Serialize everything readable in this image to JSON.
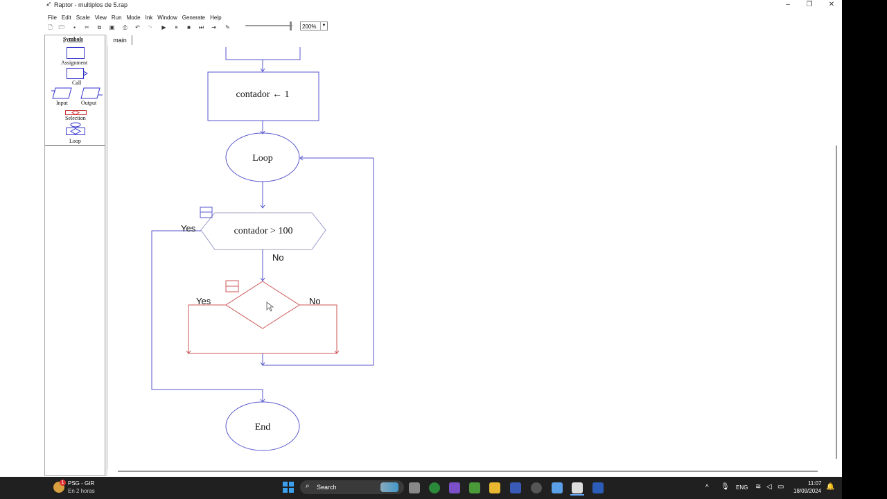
{
  "window": {
    "title": "Raptor - multiplos de 5.rap",
    "app_icon": "raptor-icon",
    "minimize": "–",
    "restore": "❐",
    "close": "✕"
  },
  "menu": [
    "File",
    "Edit",
    "Scale",
    "View",
    "Run",
    "Mode",
    "Ink",
    "Window",
    "Generate",
    "Help"
  ],
  "toolbar": {
    "buttons": [
      "new",
      "open",
      "save",
      "cut",
      "copy",
      "paste",
      "print",
      "undo",
      "redo",
      "run",
      "pause",
      "stop",
      "step",
      "step-into",
      "pen"
    ],
    "zoom": "200%"
  },
  "symbols": {
    "title": "Symbols",
    "assignment": "Assignment",
    "call": "Call",
    "input": "Input",
    "output": "Output",
    "selection": "Selection",
    "loop": "Loop"
  },
  "tabs": {
    "main": "main"
  },
  "flowchart": {
    "assignment_text": "contador ← 1",
    "loop_text": "Loop",
    "condition_text": "contador > 100",
    "loop_yes": "Yes",
    "loop_no": "No",
    "selection_yes": "Yes",
    "selection_no": "No",
    "end_text": "End",
    "colors": {
      "loop_blue": "#5555cc",
      "selection_red": "#cc5555"
    }
  },
  "taskbar": {
    "weather_badge": "1",
    "weather_line1": "PSG - GIR",
    "weather_line2": "En 2 horas",
    "search_placeholder": "Search",
    "language": "ENG",
    "time": "11:07",
    "date": "18/09/2024"
  }
}
